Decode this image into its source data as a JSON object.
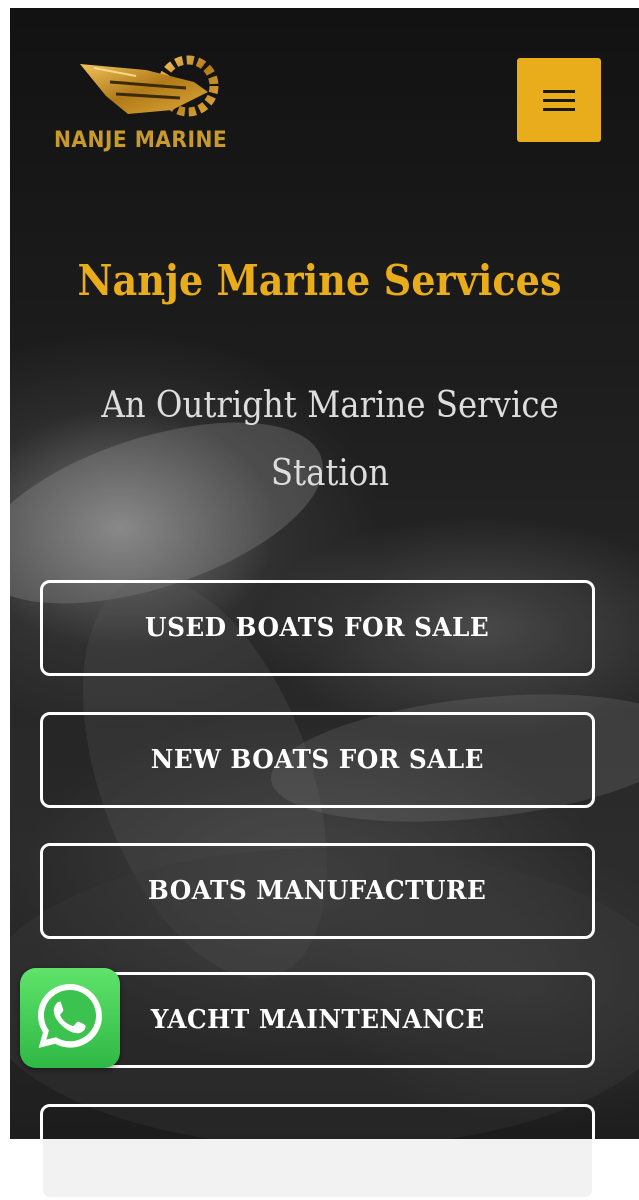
{
  "brand": {
    "logo_text": "NANJE MARINE"
  },
  "hero": {
    "title": "Nanje Marine Services",
    "tagline": "An Outright Marine Service Station"
  },
  "buttons": [
    {
      "label": "USED BOATS FOR SALE"
    },
    {
      "label": "NEW BOATS FOR SALE"
    },
    {
      "label": "BOATS MANUFACTURE"
    },
    {
      "label": "YACHT MAINTENANCE"
    },
    {
      "label": ""
    }
  ],
  "colors": {
    "accent": "#e9ad1b",
    "background": "#1c1c1c",
    "button_border": "#ffffff",
    "whatsapp": "#3cc24f"
  },
  "icons": {
    "menu": "hamburger-icon",
    "whatsapp": "whatsapp-icon",
    "logo": "boat-gear-logo-icon"
  }
}
